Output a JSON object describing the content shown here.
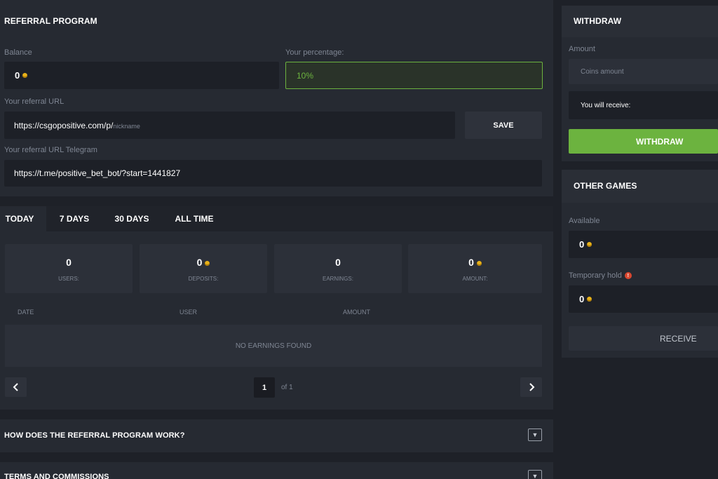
{
  "referral": {
    "title": "REFERRAL PROGRAM",
    "balance_label": "Balance",
    "balance_value": "0",
    "percentage_label": "Your percentage:",
    "percentage_value": "10%",
    "url_label": "Your referral URL",
    "url_prefix": "https://csgopositive.com/p/",
    "url_placeholder": "nickname",
    "save_label": "SAVE",
    "telegram_label": "Your referral URL Telegram",
    "telegram_value": "https://t.me/positive_bet_bot/?start=1441827"
  },
  "stats": {
    "tabs": [
      "TODAY",
      "7 DAYS",
      "30 DAYS",
      "ALL TIME"
    ],
    "active_tab": "TODAY",
    "cards": [
      {
        "value": "0",
        "caption": "USERS:",
        "coin": false
      },
      {
        "value": "0",
        "caption": "DEPOSITS:",
        "coin": true
      },
      {
        "value": "0",
        "caption": "EARNINGS:",
        "coin": false
      },
      {
        "value": "0",
        "caption": "AMOUNT:",
        "coin": true
      }
    ],
    "columns": [
      "DATE",
      "USER",
      "AMOUNT"
    ],
    "empty_text": "NO EARNINGS FOUND",
    "page": "1",
    "page_of": "of 1",
    "prev_icon": "chevron-left-icon",
    "next_icon": "chevron-right-icon"
  },
  "faq": {
    "how_title": "HOW DOES THE REFERRAL PROGRAM WORK?",
    "terms_title": "TERMS AND COMMISSIONS"
  },
  "withdraw": {
    "title": "WITHDRAW",
    "amount_label": "Amount",
    "amount_placeholder": "Coins amount",
    "receive_text": "You will receive:",
    "button_label": "WITHDRAW"
  },
  "other_games": {
    "title": "OTHER GAMES",
    "available_label": "Available",
    "available_value": "0",
    "hold_label": "Temporary hold",
    "hold_value": "0",
    "receive_label": "RECEIVE"
  },
  "colors": {
    "accent_green": "#6cb33f",
    "coin_gold": "#e8b21a",
    "info_red": "#d9472f",
    "panel": "#262a32",
    "input": "#1d2027"
  }
}
